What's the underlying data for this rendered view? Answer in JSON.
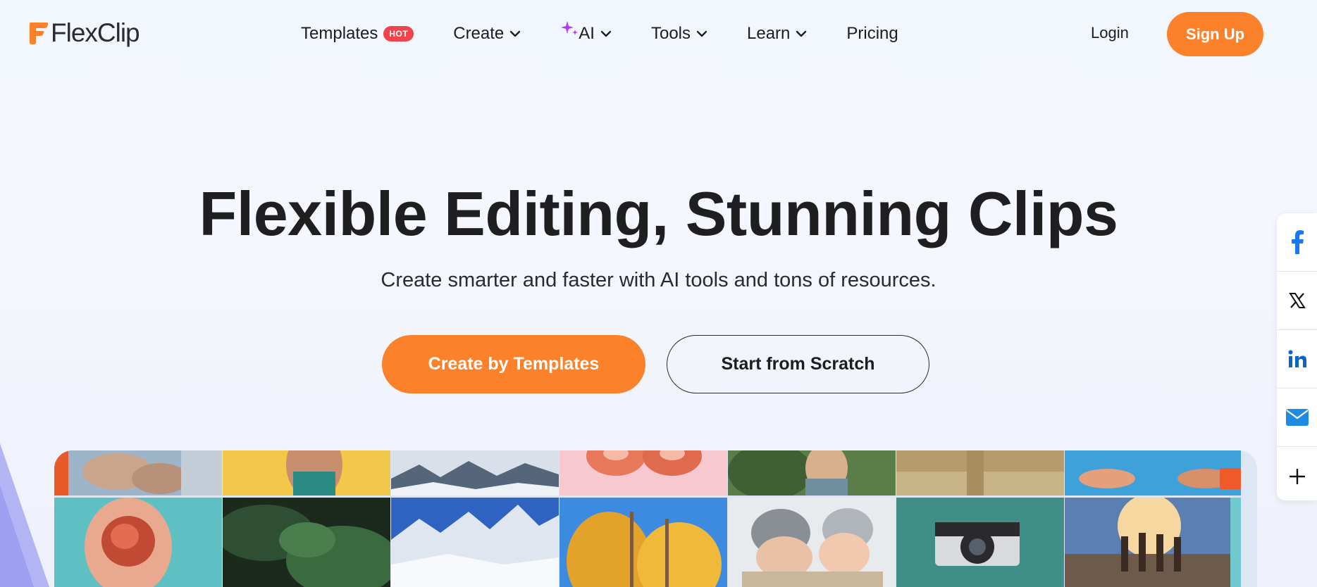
{
  "brand": {
    "name": "FlexClip",
    "accent": "#fb822a",
    "hot_color": "#f0434b",
    "ai_color": "#b43cf0"
  },
  "nav": {
    "items": [
      {
        "label": "Templates",
        "badge": "HOT"
      },
      {
        "label": "Create",
        "icon": "chevron-down-icon"
      },
      {
        "label": "AI",
        "icon": "chevron-down-icon"
      },
      {
        "label": "Tools",
        "icon": "chevron-down-icon"
      },
      {
        "label": "Learn",
        "icon": "chevron-down-icon"
      },
      {
        "label": "Pricing"
      }
    ],
    "login": "Login",
    "signup": "Sign Up"
  },
  "hero": {
    "title": "Flexible Editing, Stunning Clips",
    "subtitle": "Create smarter and faster with AI tools and tons of resources.",
    "primary_cta": "Create by Templates",
    "secondary_cta": "Start from Scratch"
  },
  "gallery": {
    "columns": [
      {
        "top": "hands-on-laptop",
        "bottom": "hand-holding-fruit"
      },
      {
        "top": "woman-yellow-background",
        "bottom": "green-plant-leaves"
      },
      {
        "top": "snowy-trees-blur",
        "bottom": "snowy-forest-road"
      },
      {
        "top": "donuts-pink",
        "bottom": "autumn-trees-sky"
      },
      {
        "top": "person-in-grass",
        "bottom": "couple-with-dog-winter"
      },
      {
        "top": "wheat-field",
        "bottom": "vintage-camera"
      },
      {
        "top": "hands-reaching-sky",
        "bottom": "friends-sunset"
      }
    ]
  },
  "social": {
    "items": [
      "facebook-icon",
      "x-icon",
      "linkedin-icon",
      "mail-icon",
      "plus-icon"
    ]
  }
}
